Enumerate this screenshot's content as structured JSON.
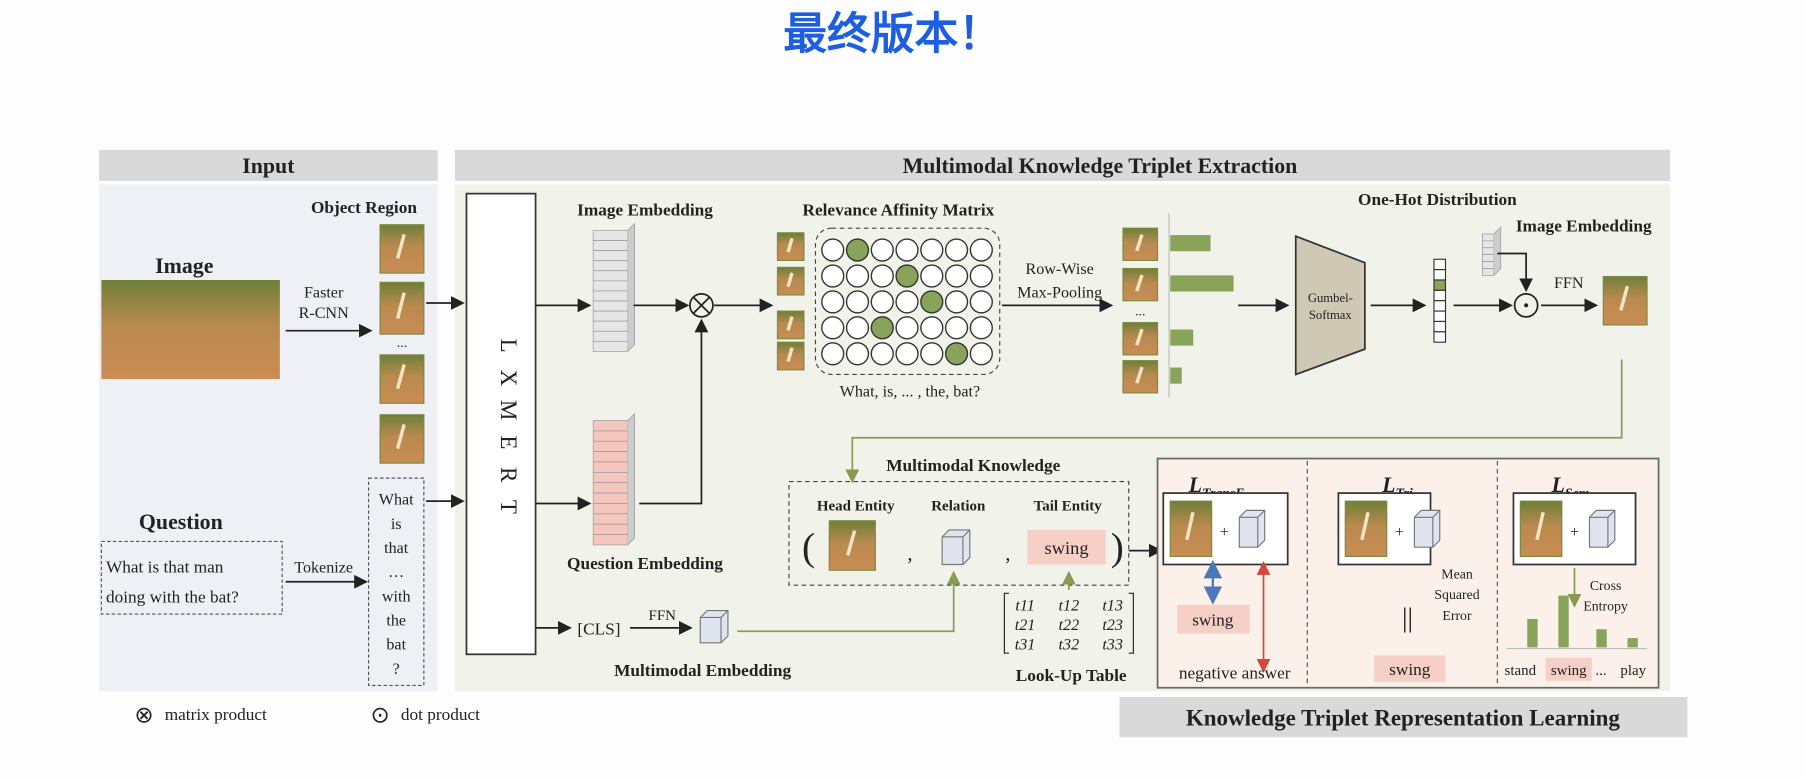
{
  "slide_title": "最终版本！",
  "colors": {
    "title": "#1d5fe0",
    "green_highlight": "#8aa35a",
    "pink_highlight": "#f6cfc6",
    "header_gray": "#d9d9d9",
    "input_bg": "#eef0f6",
    "extraction_bg": "#f1f3ea",
    "learning_bg": "#fbf0ea"
  },
  "sections": {
    "input": "Input",
    "extraction": "Multimodal Knowledge Triplet Extraction",
    "learning": "Knowledge Triplet Representation Learning"
  },
  "input": {
    "image_label": "Image",
    "detector": [
      "Faster",
      "R-CNN"
    ],
    "object_region": "Object Region",
    "ellipsis": "...",
    "question_label": "Question",
    "question_text": [
      "What is that man",
      "doing with the bat?"
    ],
    "tokenize": "Tokenize",
    "tokens": [
      "What",
      "is",
      "that",
      "…",
      "with",
      "the",
      "bat",
      "?"
    ]
  },
  "encoder": {
    "letters": [
      "L",
      "X",
      "M",
      "E",
      "R",
      "T"
    ]
  },
  "extraction": {
    "image_embedding": "Image Embedding",
    "question_embedding": "Question Embedding",
    "matrix_title": "Relevance Affinity Matrix",
    "matrix_caption": "What, is, ... , the, bat?",
    "matrix_highlight_columns_per_row": [
      1,
      3,
      4,
      2,
      5
    ],
    "pooling": [
      "Row-Wise",
      "Max-Pooling"
    ],
    "one_hot": "One-Hot Distribution",
    "gumbel": [
      "Gumbel-",
      "Softmax"
    ],
    "image_embedding_2": "Image Embedding",
    "ffn": "FFN",
    "cls": "[CLS]",
    "ffn2": "FFN",
    "multimodal_embedding": "Multimodal Embedding",
    "ellipsis": "..."
  },
  "knowledge": {
    "title": "Multimodal Knowledge",
    "head": "Head Entity",
    "relation": "Relation",
    "tail": "Tail Entity",
    "tail_value": "swing",
    "open_paren": "(",
    "close_paren": ")",
    "comma": ",",
    "lookup_label": "Look-Up Table",
    "lookup_rows": [
      [
        "t11",
        "t12",
        "t13"
      ],
      [
        "t21",
        "t22",
        "t23"
      ],
      [
        "t31",
        "t32",
        "t33"
      ]
    ]
  },
  "learning": {
    "transe": {
      "L": "L",
      "sub": "TransE",
      "answer": "swing",
      "negative": "negative answer"
    },
    "tri": {
      "L": "L",
      "sub": "Tri",
      "mse": [
        "Mean",
        "Squared",
        "Error"
      ],
      "answer": "swing",
      "parallel": "||"
    },
    "sem": {
      "L": "L",
      "sub": "Sem",
      "ce": [
        "Cross",
        "Entropy"
      ],
      "labels": [
        "stand",
        "swing",
        "...",
        "play"
      ],
      "bar_values": [
        0.55,
        1.0,
        0.35,
        0.18
      ]
    },
    "plus": "+"
  },
  "legend": {
    "matrix_product_symbol": "⊗",
    "matrix_product": "matrix product",
    "dot_product_symbol": "⊙",
    "dot_product": "dot product"
  }
}
